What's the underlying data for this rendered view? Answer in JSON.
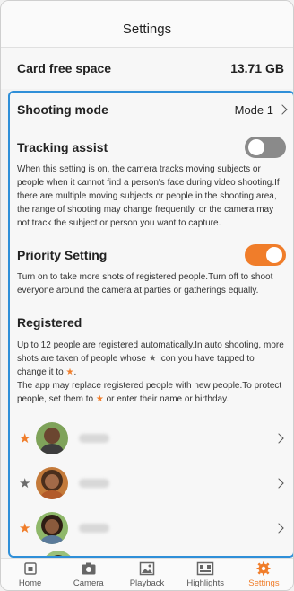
{
  "header": {
    "title": "Settings"
  },
  "card": {
    "label": "Card free space",
    "value": "13.71 GB"
  },
  "shooting_mode": {
    "label": "Shooting mode",
    "value": "Mode 1"
  },
  "tracking": {
    "label": "Tracking assist",
    "enabled": false,
    "description": "When this setting is on, the camera tracks moving subjects or people when it cannot find a person's face during video shooting.If there are multiple moving subjects or people in the shooting area, the range of shooting may change frequently, or the camera may not track the subject or person you want to capture."
  },
  "priority": {
    "label": "Priority Setting",
    "enabled": true,
    "description": "Turn on to take more shots of registered people.Turn off to shoot everyone around the camera at parties or gatherings equally."
  },
  "registered": {
    "label": "Registered",
    "desc_part1": "Up to 12 people are registered automatically.In auto shooting, more shots are taken of people whose",
    "desc_part2": "icon you have tapped to change it to",
    "desc_part3": ".",
    "desc_part4": "The app may replace registered people with new people.To protect people, set them to",
    "desc_part5": "or enter their name or birthday.",
    "star_glyph": "★",
    "people": [
      {
        "starred": true,
        "star": "★"
      },
      {
        "starred": false,
        "star": "★"
      },
      {
        "starred": true,
        "star": "★"
      }
    ]
  },
  "colors": {
    "accent": "#f07d2a",
    "selection_border": "#2f8fd8",
    "star_gray": "#6b6b6b"
  },
  "tabs": [
    {
      "label": "Home",
      "icon": "home-icon"
    },
    {
      "label": "Camera",
      "icon": "camera-icon"
    },
    {
      "label": "Playback",
      "icon": "playback-icon"
    },
    {
      "label": "Highlights",
      "icon": "highlights-icon"
    },
    {
      "label": "Settings",
      "icon": "gear-icon",
      "active": true
    }
  ]
}
